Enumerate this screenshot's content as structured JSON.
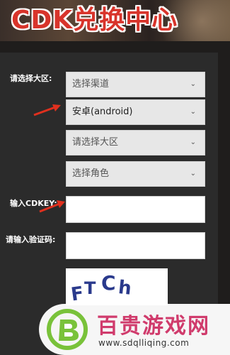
{
  "banner": {
    "title": "CDK兑换中心"
  },
  "form": {
    "region_label": "请选择大区:",
    "channel_select": "选择渠道",
    "platform_select": "安卓(android)",
    "region_select": "请选择大区",
    "role_select": "选择角色",
    "cdkey_label": "输入CDKEY:",
    "cdkey_value": "",
    "captcha_label": "请输入验证码:",
    "captcha_value": "",
    "captcha_text": "FTCh"
  },
  "watermark": {
    "name": "百贵游戏网",
    "url": "www.sdqlliqing.com"
  },
  "colors": {
    "title_red": "#d8342b",
    "arrow_red": "#e0301e",
    "watermark_pink": "#d03b6c",
    "logo_green": "#79c23a"
  }
}
